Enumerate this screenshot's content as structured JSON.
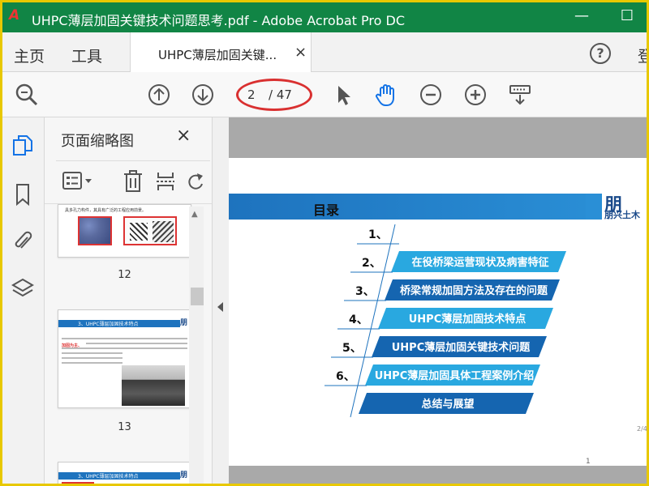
{
  "window": {
    "logo_glyph": "A",
    "title": "UHPC薄层加固关键技术问题思考.pdf - Adobe Acrobat Pro DC",
    "minimize_glyph": "—",
    "maximize_glyph": "☐"
  },
  "tabs": {
    "home": "主页",
    "tools": "工具",
    "document": "UHPC薄层加固关键...",
    "close_glyph": "×",
    "help_glyph": "?",
    "right_clipped": "登"
  },
  "toolbar": {
    "current_page": "2",
    "total_pages": "/ 47",
    "icons": [
      "search-zoom-icon",
      "page-up-icon",
      "page-down-icon",
      "select-arrow-icon",
      "hand-tool-icon",
      "zoom-out-icon",
      "zoom-in-icon",
      "keyboard-icon"
    ]
  },
  "left_rail": {
    "icons": [
      "page-thumbnails-icon",
      "bookmark-icon",
      "attachment-icon",
      "layers-icon"
    ]
  },
  "thumbnails": {
    "title": "页面缩略图",
    "close_glyph": "×",
    "items": [
      {
        "label": "12",
        "header": "具多孔力构件，其具有广泛的工程应用前景。"
      },
      {
        "label": "13",
        "header": "3、UHPC薄层加固技术特点",
        "body_red": "加固为主、",
        "body": "UHPC薄层加固技术成功应用于铺装层更换—普通混凝土桥梁修复，由于UHPC超高强度..."
      },
      {
        "label": "",
        "header": "3、UHPC薄层加固技术特点"
      }
    ]
  },
  "document": {
    "section_title": "目录",
    "logo_text": "朋兴土木",
    "page_number": "1",
    "side_fraction": "2/4",
    "toc": [
      {
        "num": "1、",
        "text": ""
      },
      {
        "num": "2、",
        "text": "在役桥梁运营现状及病害特征"
      },
      {
        "num": "3、",
        "text": "桥梁常规加固方法及存在的问题"
      },
      {
        "num": "4、",
        "text": "UHPC薄层加固技术特点"
      },
      {
        "num": "5、",
        "text": "UHPC薄层加固关键技术问题"
      },
      {
        "num": "6、",
        "text": "UHPC薄层加固具体工程案例介绍"
      },
      {
        "num": "",
        "text": "总结与展望"
      }
    ]
  },
  "colors": {
    "titlebar": "#118545",
    "accent_blue": "#1e73be",
    "toc_light": "#29a8e0",
    "toc_dark": "#1565b0",
    "annotation_red": "#d93030"
  }
}
